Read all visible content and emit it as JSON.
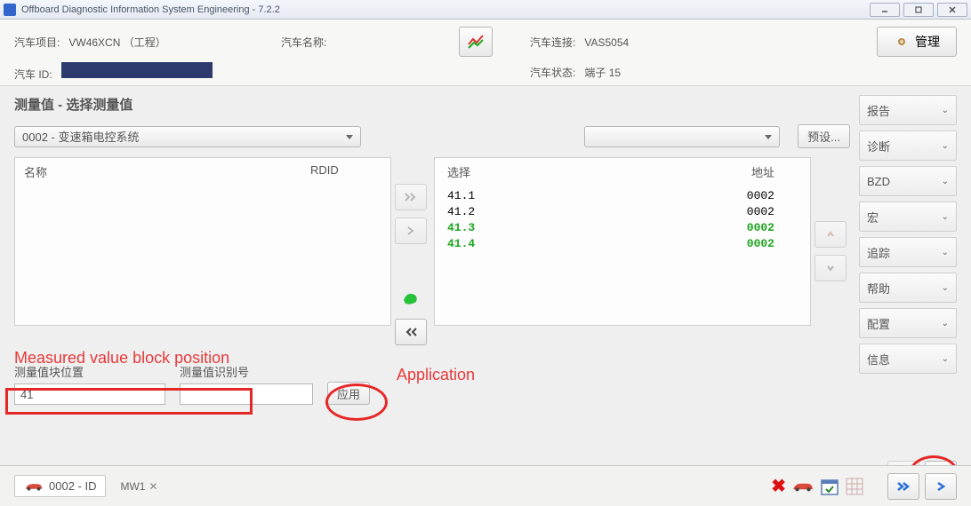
{
  "window": {
    "title": "Offboard Diagnostic Information System Engineering - 7.2.2"
  },
  "header": {
    "project_label": "汽车项目:",
    "project_value": "VW46XCN （工程）",
    "name_label": "汽车名称:",
    "id_label": "汽车 ID:",
    "connection_label": "汽车连接:",
    "connection_value": "VAS5054",
    "status_label": "汽车状态:",
    "status_value": "端子 15",
    "manage_label": "管理"
  },
  "section": {
    "title": "测量值 - 选择测量值"
  },
  "system_select": {
    "value": "0002 - 变速箱电控系统"
  },
  "preset": {
    "button": "预设..."
  },
  "left_list": {
    "col1": "名称",
    "col2": "RDID"
  },
  "right_list": {
    "col1": "选择",
    "col2": "地址",
    "rows": [
      {
        "sel": "41.1",
        "addr": "0002",
        "hl": false
      },
      {
        "sel": "41.2",
        "addr": "0002",
        "hl": false
      },
      {
        "sel": "41.3",
        "addr": "0002",
        "hl": true
      },
      {
        "sel": "41.4",
        "addr": "0002",
        "hl": true
      }
    ]
  },
  "mv": {
    "pos_label": "测量值块位置",
    "rid_label": "测量值识别号",
    "pos_value": "41",
    "apply_label": "应用"
  },
  "annotations": {
    "pos": "Measured value block position",
    "apply": "Application"
  },
  "sidebar": {
    "items": [
      {
        "label": "报告"
      },
      {
        "label": "诊断"
      },
      {
        "label": "BZD"
      },
      {
        "label": "宏"
      },
      {
        "label": "追踪"
      },
      {
        "label": "帮助"
      },
      {
        "label": "配置"
      },
      {
        "label": "信息"
      }
    ]
  },
  "footer": {
    "module": "0002 - ID",
    "tab": "MW1"
  }
}
